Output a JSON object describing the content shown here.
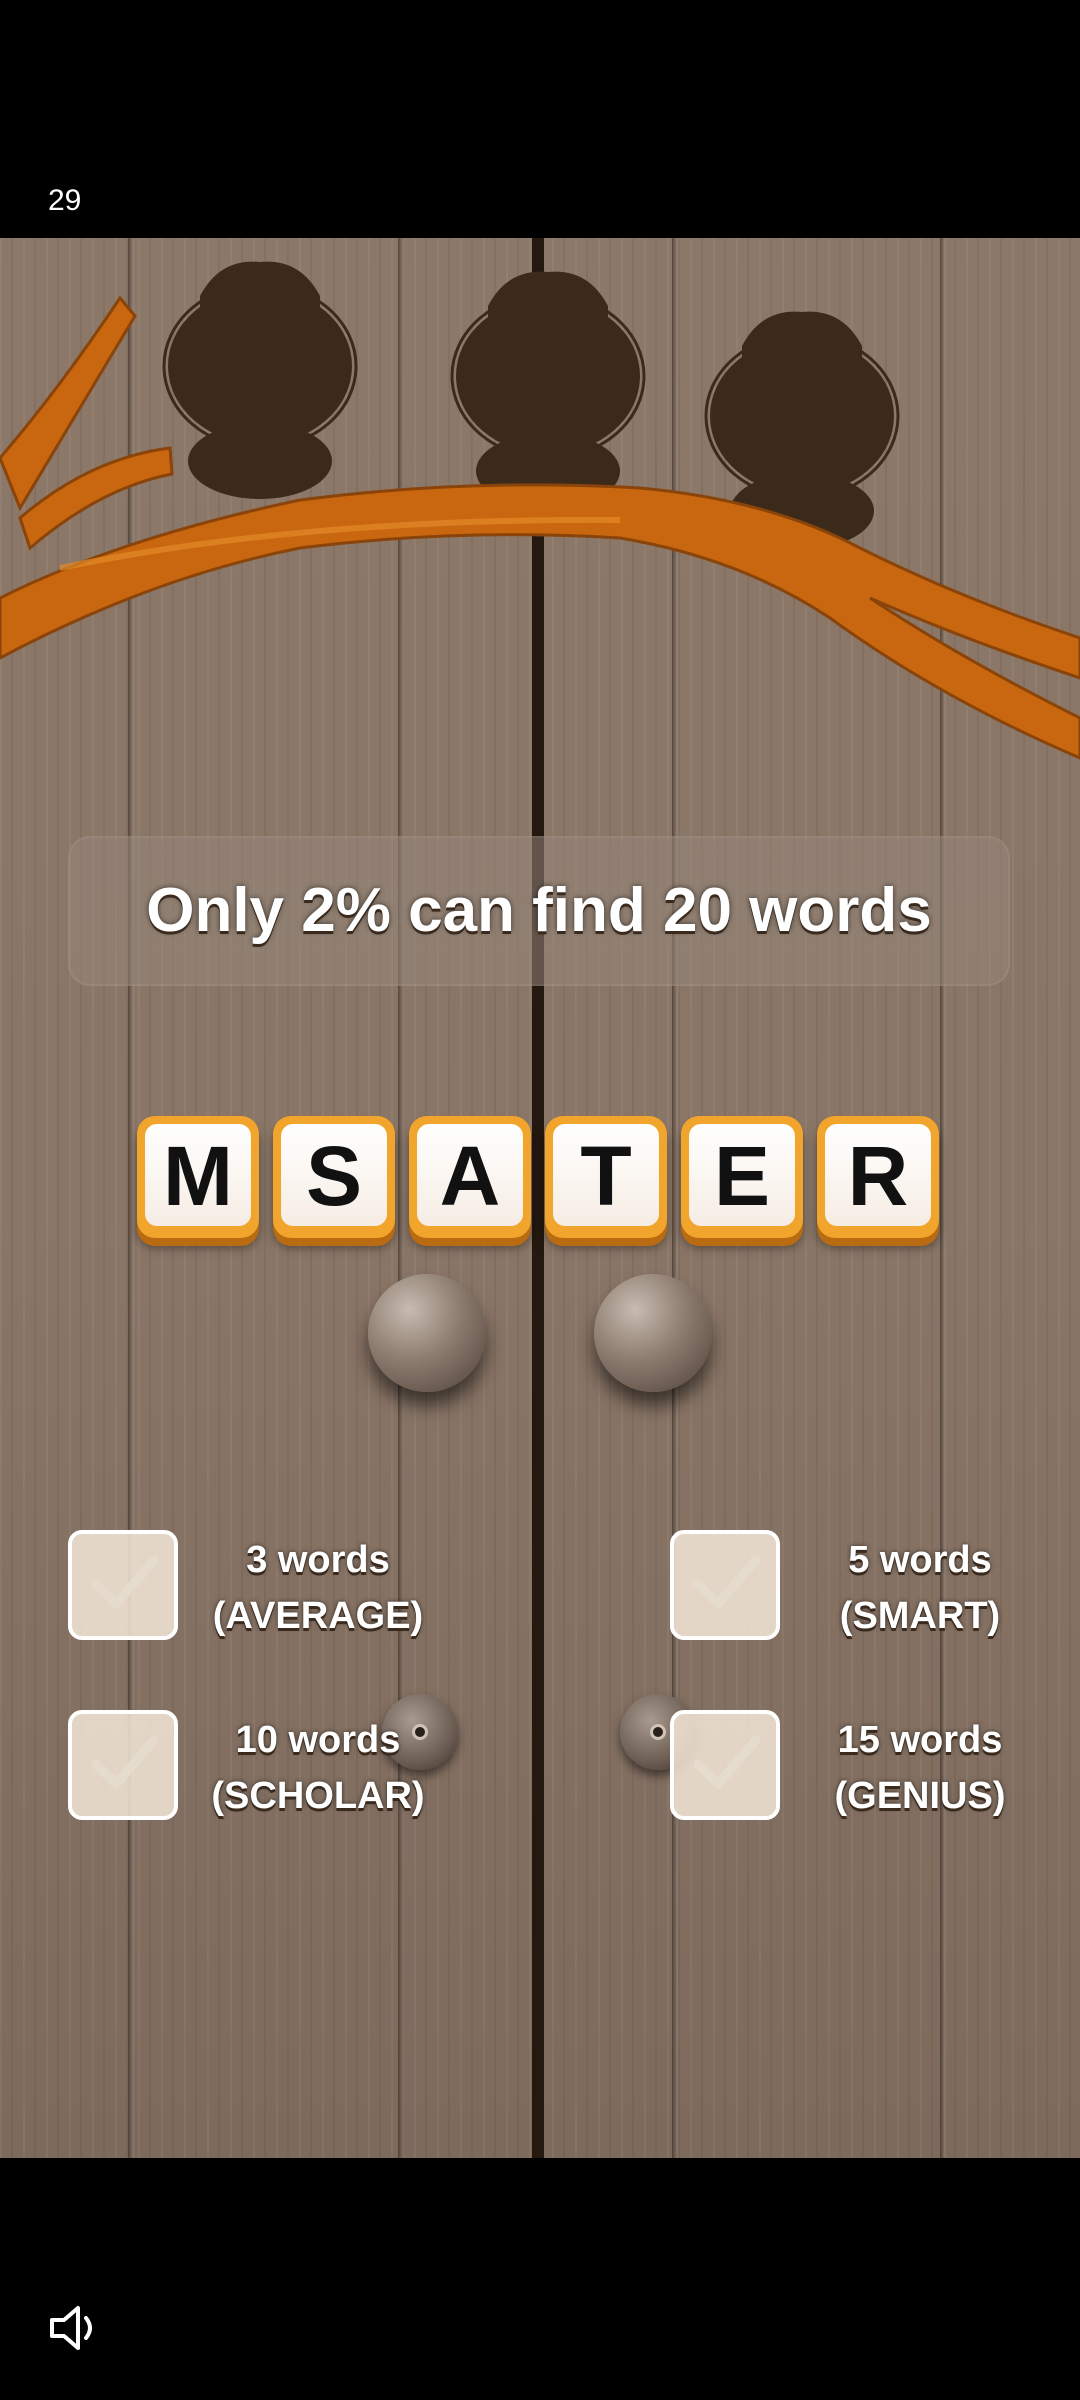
{
  "status_bar": {
    "time": "29"
  },
  "challenge": {
    "text": "Only 2% can find 20 words"
  },
  "letters": [
    "M",
    "S",
    "A",
    "T",
    "E",
    "R"
  ],
  "goals": [
    {
      "count": "3 words",
      "rank": "(AVERAGE)"
    },
    {
      "count": "5 words",
      "rank": "(SMART)"
    },
    {
      "count": "10 words",
      "rank": "(SCHOLAR)"
    },
    {
      "count": "15 words",
      "rank": "(GENIUS)"
    }
  ],
  "colors": {
    "tile_border": "#f2a52c",
    "owl_silhouette": "#3b2a1a",
    "branch": "#c8670f",
    "wood": "#8c7868"
  },
  "icons": {
    "sound": "speaker-icon",
    "check": "check-icon"
  }
}
